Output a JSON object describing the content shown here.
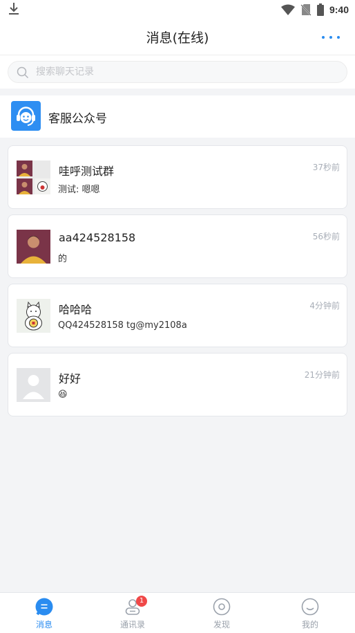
{
  "status_bar": {
    "time": "9:40"
  },
  "header": {
    "title": "消息(在线)",
    "more_icon": "more-dots-icon"
  },
  "search": {
    "placeholder": "搜索聊天记录",
    "value": ""
  },
  "service": {
    "label": "客服公众号",
    "icon": "headset-icon"
  },
  "chats": [
    {
      "name": "哇呼测试群",
      "preview": "测试: 嗯嗯",
      "time": "37秒前",
      "avatar": "group-avatar"
    },
    {
      "name": "aa424528158",
      "preview": "的",
      "time": "56秒前",
      "avatar": "person-avatar"
    },
    {
      "name": "哈哈哈",
      "preview": "QQ424528158 tg@my2108a",
      "time": "4分钟前",
      "avatar": "lucky-cat-avatar"
    },
    {
      "name": "好好",
      "preview": "😆",
      "time": "21分钟前",
      "avatar": "default-avatar"
    }
  ],
  "nav": [
    {
      "label": "消息",
      "icon": "message-icon",
      "active": true
    },
    {
      "label": "通讯录",
      "icon": "contacts-icon",
      "badge": "1"
    },
    {
      "label": "发现",
      "icon": "discover-icon"
    },
    {
      "label": "我的",
      "icon": "profile-icon"
    }
  ],
  "colors": {
    "accent": "#2a8cf0",
    "badge": "#f04848",
    "service_icon_bg": "#2e8ef2"
  }
}
